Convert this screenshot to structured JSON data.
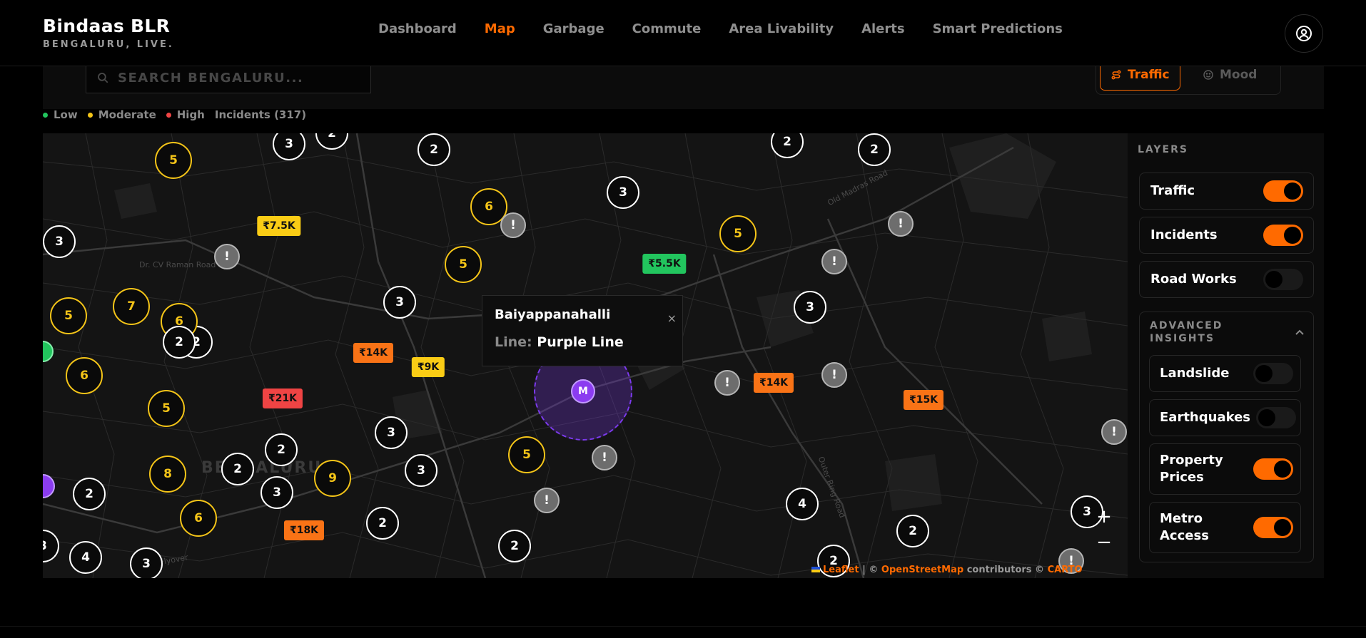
{
  "brand": {
    "title": "Bindaas BLR",
    "subtitle": "BENGALURU, LIVE."
  },
  "nav": [
    {
      "label": "Dashboard",
      "active": false
    },
    {
      "label": "Map",
      "active": true
    },
    {
      "label": "Garbage",
      "active": false
    },
    {
      "label": "Commute",
      "active": false
    },
    {
      "label": "Area Livability",
      "active": false
    },
    {
      "label": "Alerts",
      "active": false
    },
    {
      "label": "Smart Predictions",
      "active": false
    }
  ],
  "account": {
    "icon": "user-circle-icon"
  },
  "search": {
    "placeholder": "SEARCH BENGALURU..."
  },
  "modes": {
    "traffic": "Traffic",
    "mood": "Mood",
    "active": "Traffic"
  },
  "legend": {
    "low": "Low",
    "moderate": "Moderate",
    "high": "High",
    "incidents": "Incidents (317)",
    "colors": {
      "low": "#22c55e",
      "moderate": "#f5c518",
      "high": "#ef4444"
    }
  },
  "map": {
    "city_label": "BENGALURU",
    "road_labels": [
      "Dr. CV Raman Road",
      "Old Madras Road",
      "Outer Ring Road",
      "BCS Flyover"
    ],
    "popup": {
      "title": "Baiyappanahalli",
      "line_label": "Line:",
      "line_value": "Purple Line",
      "close": "×"
    },
    "metro_marker": "M",
    "clusters_white": [
      "3",
      "2",
      "2",
      "2",
      "2",
      "3",
      "3",
      "3",
      "3",
      "3",
      "2",
      "3",
      "2",
      "3",
      "2",
      "3",
      "2",
      "4",
      "2",
      "4",
      "2",
      "3",
      "3",
      "2"
    ],
    "clusters_yellow": [
      "5",
      "6",
      "5",
      "5",
      "5",
      "7",
      "6",
      "6",
      "5",
      "8",
      "9",
      "6",
      "5"
    ],
    "prices": [
      {
        "label": "₹7.5K",
        "color": "#facc15"
      },
      {
        "label": "₹5.5K",
        "color": "#22c55e"
      },
      {
        "label": "₹14K",
        "color": "#f97316"
      },
      {
        "label": "₹9K",
        "color": "#facc15"
      },
      {
        "label": "₹21K",
        "color": "#ef4444"
      },
      {
        "label": "₹14K",
        "color": "#f97316"
      },
      {
        "label": "₹15K",
        "color": "#f97316"
      },
      {
        "label": "₹18K",
        "color": "#f97316"
      }
    ],
    "incident_symbol": "!",
    "zoom_in": "+",
    "zoom_out": "−",
    "attribution": {
      "leaflet": "Leaflet",
      "sep1": "| ©",
      "osm": "OpenStreetMap",
      "contrib": "contributors ©",
      "carto": "CARTO"
    }
  },
  "layers": {
    "title": "LAYERS",
    "items": [
      {
        "label": "Traffic",
        "on": true
      },
      {
        "label": "Incidents",
        "on": true
      },
      {
        "label": "Road Works",
        "on": false
      }
    ],
    "advanced": {
      "title": "ADVANCED INSIGHTS",
      "items": [
        {
          "label": "Landslide",
          "on": false
        },
        {
          "label": "Earthquakes",
          "on": false
        },
        {
          "label": "Property Prices",
          "on": true
        },
        {
          "label": "Metro Access",
          "on": true
        }
      ]
    }
  }
}
